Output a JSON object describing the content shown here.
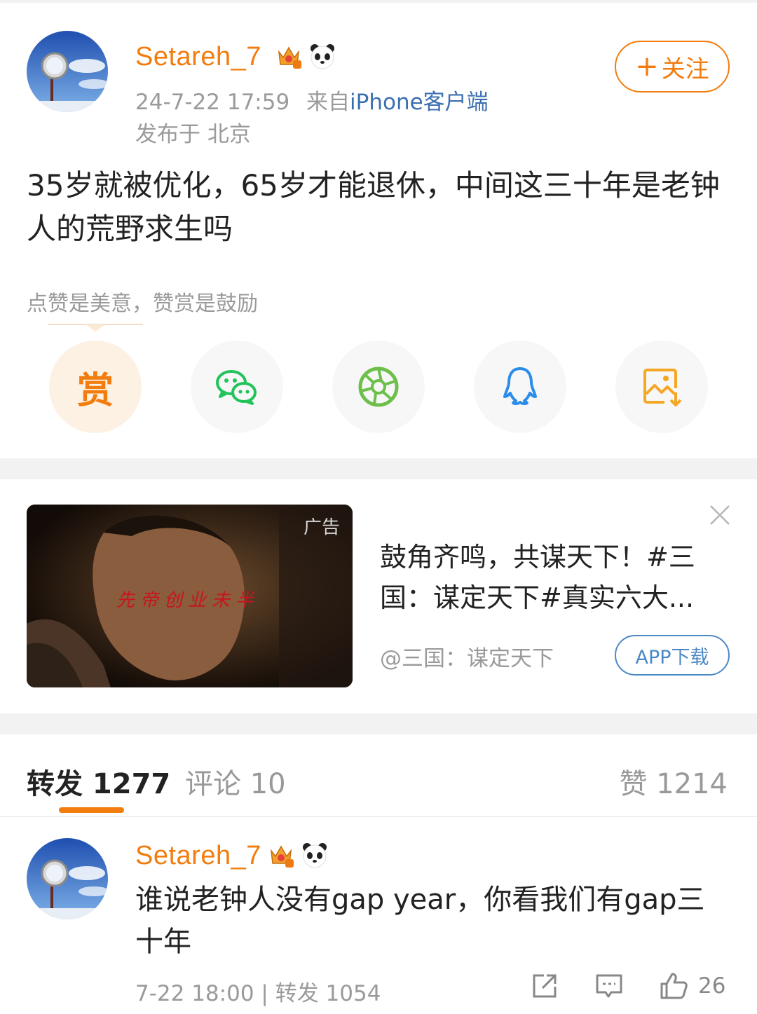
{
  "post": {
    "author": "Setareh_7",
    "timestamp": "24-7-22 17:59",
    "from_label": "来自",
    "source": "iPhone客户端",
    "location": "发布于 北京",
    "follow_plus": "+",
    "follow_label": "关注",
    "text": "35岁就被优化，65岁才能退休，中间这三十年是老钟人的荒野求生吗"
  },
  "reward": {
    "hint": "点赞是美意，赞赏是鼓励",
    "button_label": "赏"
  },
  "share_icons": [
    "wechat-icon",
    "moments-icon",
    "qq-icon",
    "save-image-icon"
  ],
  "ad": {
    "tag": "广告",
    "overlay_text": "先帝创业未半",
    "title": "鼓角齐鸣，共谋天下！#三国：谋定天下#真实六大...",
    "source": "@三国：谋定天下",
    "download_label": "APP下载"
  },
  "tabs": {
    "repost": "转发 1277",
    "comments": "评论 10",
    "likes": "赞 1214"
  },
  "comment": {
    "author": "Setareh_7",
    "text": "谁说老钟人没有gap year，你看我们有gap三十年",
    "meta": "7-22 18:00 | 转发 1054",
    "like_count": "26"
  },
  "colors": {
    "accent": "#f27c0d",
    "link": "#3b6fb0",
    "ad_button": "#4c88c5"
  }
}
